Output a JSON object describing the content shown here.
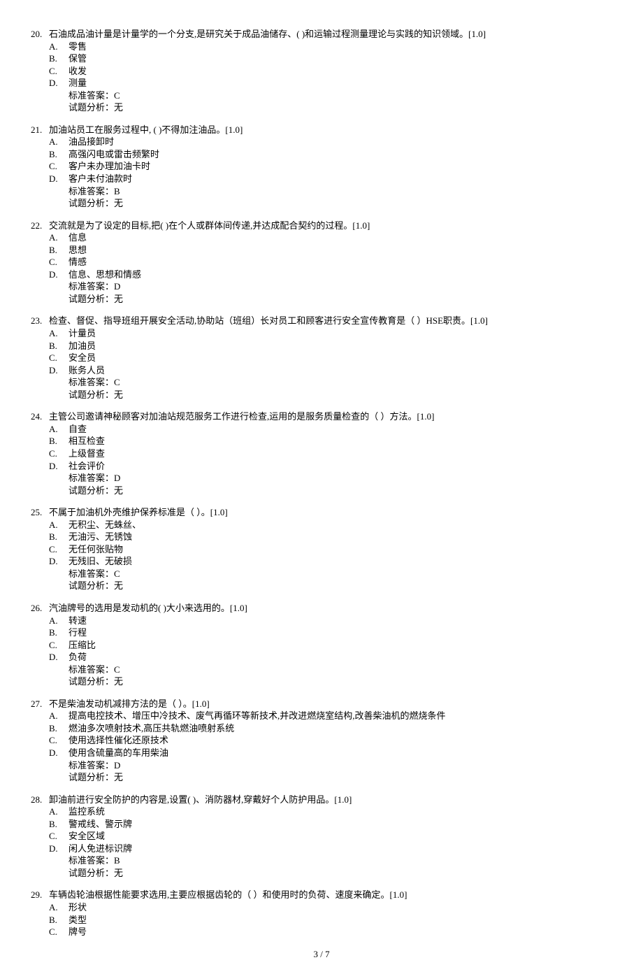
{
  "page": {
    "current": "3",
    "total": "7",
    "sep": " / "
  },
  "labels": {
    "answer_prefix": "标准答案：",
    "analysis_prefix": "试题分析：",
    "analysis_none": "无"
  },
  "questions": [
    {
      "num": "20.",
      "stem": "石油成品油计量是计量学的一个分支,是研究关于成品油储存、(    )和运输过程测量理论与实践的知识领域。[1.0]",
      "options": [
        {
          "letter": "A.",
          "text": "零售"
        },
        {
          "letter": "B.",
          "text": "保管"
        },
        {
          "letter": "C.",
          "text": "收发"
        },
        {
          "letter": "D.",
          "text": "测量"
        }
      ],
      "answer": "C"
    },
    {
      "num": "21.",
      "stem": "加油站员工在服务过程中, (    )不得加注油品。[1.0]",
      "options": [
        {
          "letter": "A.",
          "text": "油品接卸时"
        },
        {
          "letter": "B.",
          "text": "高强闪电或雷击频繁时"
        },
        {
          "letter": "C.",
          "text": "客户未办理加油卡时"
        },
        {
          "letter": "D.",
          "text": "客户未付油款时"
        }
      ],
      "answer": "B"
    },
    {
      "num": "22.",
      "stem": "交流就是为了设定的目标,把(      )在个人或群体间传递,并达成配合契约的过程。[1.0]",
      "options": [
        {
          "letter": "A.",
          "text": "信息"
        },
        {
          "letter": "B.",
          "text": "思想"
        },
        {
          "letter": "C.",
          "text": "情感"
        },
        {
          "letter": "D.",
          "text": "信息、思想和情感"
        }
      ],
      "answer": "D"
    },
    {
      "num": "23.",
      "stem": "检查、督促、指导班组开展安全活动,协助站（班组）长对员工和顾客进行安全宣传教育是（   ）HSE职责。[1.0]",
      "options": [
        {
          "letter": "A.",
          "text": "计量员"
        },
        {
          "letter": "B.",
          "text": "加油员"
        },
        {
          "letter": "C.",
          "text": "安全员"
        },
        {
          "letter": "D.",
          "text": "账务人员"
        }
      ],
      "answer": "C"
    },
    {
      "num": "24.",
      "stem": "主管公司邀请神秘顾客对加油站规范服务工作进行检查,运用的是服务质量检查的（    ）方法。[1.0]",
      "options": [
        {
          "letter": "A.",
          "text": "自查"
        },
        {
          "letter": "B.",
          "text": "相互检查"
        },
        {
          "letter": "C.",
          "text": "上级督查"
        },
        {
          "letter": "D.",
          "text": "社会评价"
        }
      ],
      "answer": "D"
    },
    {
      "num": "25.",
      "stem": "不属于加油机外壳维护保养标准是（ ）。[1.0]",
      "options": [
        {
          "letter": "A.",
          "text": "无积尘、无蛛丝、"
        },
        {
          "letter": "B.",
          "text": "无油污、无锈蚀"
        },
        {
          "letter": "C.",
          "text": "无任何张贴物"
        },
        {
          "letter": "D.",
          "text": "无残旧、无破损"
        }
      ],
      "answer": "C"
    },
    {
      "num": "26.",
      "stem": "汽油牌号的选用是发动机的(      )大小来选用的。[1.0]",
      "options": [
        {
          "letter": "A.",
          "text": "转速"
        },
        {
          "letter": "B.",
          "text": "行程"
        },
        {
          "letter": "C.",
          "text": "压缩比"
        },
        {
          "letter": "D.",
          "text": "负荷"
        }
      ],
      "answer": "C"
    },
    {
      "num": "27.",
      "stem": "不是柴油发动机减排方法的是（   ）。[1.0]",
      "options": [
        {
          "letter": "A.",
          "text": "提高电控技术、增压中冷技术、废气再循环等新技术,并改进燃烧室结构,改善柴油机的燃烧条件"
        },
        {
          "letter": "B.",
          "text": "燃油多次喷射技术,高压共轨燃油喷射系统"
        },
        {
          "letter": "C.",
          "text": "使用选择性催化还原技术"
        },
        {
          "letter": "D.",
          "text": "使用含硫量高的车用柴油"
        }
      ],
      "answer": "D"
    },
    {
      "num": "28.",
      "stem": "卸油前进行安全防护的内容是,设置(      )、消防器材,穿戴好个人防护用品。[1.0]",
      "options": [
        {
          "letter": "A.",
          "text": "监控系统"
        },
        {
          "letter": "B.",
          "text": "警戒线、警示牌"
        },
        {
          "letter": "C.",
          "text": "安全区域"
        },
        {
          "letter": "D.",
          "text": "闲人免进标识牌"
        }
      ],
      "answer": "B"
    },
    {
      "num": "29.",
      "stem": "车辆齿轮油根据性能要求选用,主要应根据齿轮的（    ）和使用时的负荷、速度来确定。[1.0]",
      "options": [
        {
          "letter": "A.",
          "text": "形状"
        },
        {
          "letter": "B.",
          "text": "类型"
        },
        {
          "letter": "C.",
          "text": "牌号"
        }
      ],
      "partial": true
    }
  ]
}
